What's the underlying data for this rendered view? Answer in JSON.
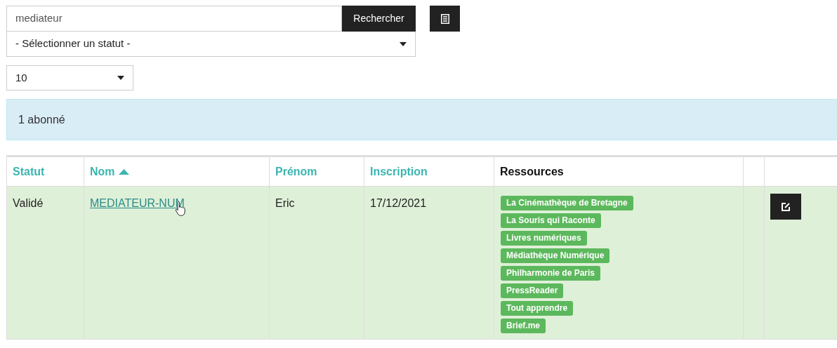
{
  "search": {
    "value": "mediateur",
    "button": "Rechercher"
  },
  "status_select": {
    "value": "- Sélectionner un statut -"
  },
  "page_size_select": {
    "value": "10"
  },
  "result_count": "1 abonné",
  "table": {
    "columns": [
      {
        "label": "Statut",
        "sortable": true,
        "sorted": false
      },
      {
        "label": "Nom",
        "sortable": true,
        "sorted": true
      },
      {
        "label": "Prénom",
        "sortable": true,
        "sorted": false
      },
      {
        "label": "Inscription",
        "sortable": true,
        "sorted": false
      },
      {
        "label": "Ressources",
        "sortable": false,
        "sorted": false
      }
    ],
    "rows": [
      {
        "statut": "Validé",
        "nom": "MEDIATEUR-NUM",
        "prenom": "Eric",
        "inscription": "17/12/2021",
        "hovered": true,
        "ressources": [
          "La Cinémathèque de Bretagne",
          "La Souris qui Raconte",
          "Livres numériques",
          "Médiathèque Numérique",
          "Philharmonie de Paris",
          "PressReader",
          "Tout apprendre",
          "Brief.me"
        ]
      }
    ]
  }
}
